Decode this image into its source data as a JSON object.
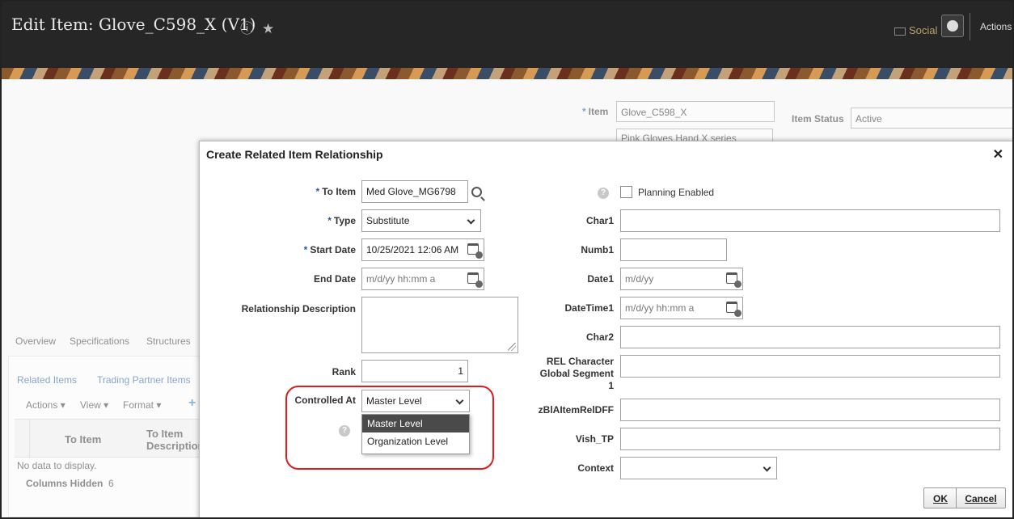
{
  "header": {
    "title": "Edit Item: Glove_C598_X (V1)",
    "help_icon": "help-circle-icon",
    "favorite_icon": "star-icon",
    "social_label": "Social",
    "actions_label": "Actions"
  },
  "background": {
    "item_label": "Item",
    "item_value": "Glove_C598_X",
    "description_value": "Pink Gloves Hand X series",
    "item_status_label": "Item Status",
    "item_status_value": "Active",
    "tabs": [
      "Overview",
      "Specifications",
      "Structures"
    ],
    "subtabs": [
      "Related Items",
      "Trading Partner Items"
    ],
    "toolbar": [
      "Actions",
      "View",
      "Format"
    ],
    "columns": [
      "To Item",
      "To Item Description"
    ],
    "no_data": "No data to display.",
    "columns_hidden_label": "Columns Hidden",
    "columns_hidden_count": "6"
  },
  "dialog": {
    "title": "Create Related Item Relationship",
    "left": {
      "to_item_label": "To Item",
      "to_item_value": "Med Glove_MG6798",
      "type_label": "Type",
      "type_value": "Substitute",
      "start_date_label": "Start Date",
      "start_date_value": "10/25/2021 12:06 AM",
      "end_date_label": "End Date",
      "end_date_placeholder": "m/d/yy hh:mm a",
      "relationship_description_label": "Relationship Description",
      "rank_label": "Rank",
      "rank_value": "1",
      "controlled_at_label": "Controlled At",
      "controlled_at_value": "Master Level",
      "controlled_at_options": [
        "Master Level",
        "Organization Level"
      ]
    },
    "right": {
      "planning_enabled_label": "Planning Enabled",
      "char1_label": "Char1",
      "numb1_label": "Numb1",
      "date1_label": "Date1",
      "date1_placeholder": "m/d/yy",
      "datetime1_label": "DateTime1",
      "datetime1_placeholder": "m/d/yy hh:mm a",
      "char2_label": "Char2",
      "rel_char_label": "REL Character Global Segment 1",
      "zbl_label": "zBlAItemRelDFF",
      "vish_label": "Vish_TP",
      "context_label": "Context"
    },
    "ok_label": "OK",
    "cancel_label": "Cancel"
  },
  "annotation": {
    "color": "#e01b1b"
  }
}
